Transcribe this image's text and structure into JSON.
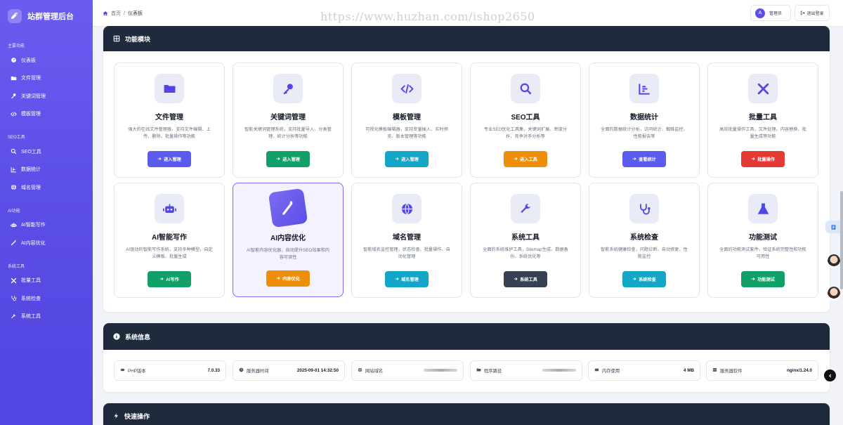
{
  "app": {
    "title": "站群管理后台"
  },
  "sidebar": {
    "sections": [
      {
        "title": "主要功能",
        "items": [
          {
            "label": "仪表板",
            "icon": "dashboard-icon"
          },
          {
            "label": "文件管理",
            "icon": "folder-icon"
          },
          {
            "label": "关键词管理",
            "icon": "key-icon"
          },
          {
            "label": "模板管理",
            "icon": "code-icon"
          }
        ]
      },
      {
        "title": "SEO工具",
        "items": [
          {
            "label": "SEO工具",
            "icon": "search-icon"
          },
          {
            "label": "数据统计",
            "icon": "chart-icon"
          },
          {
            "label": "域名管理",
            "icon": "globe-icon"
          }
        ]
      },
      {
        "title": "AI功能",
        "items": [
          {
            "label": "AI智能写作",
            "icon": "robot-icon"
          },
          {
            "label": "AI内容优化",
            "icon": "magic-icon"
          }
        ]
      },
      {
        "title": "系统工具",
        "items": [
          {
            "label": "批量工具",
            "icon": "tools-icon"
          },
          {
            "label": "系统检查",
            "icon": "stethoscope-icon"
          },
          {
            "label": "系统工具",
            "icon": "wrench-icon"
          }
        ]
      }
    ]
  },
  "topbar": {
    "breadcrumb": {
      "home": "首页",
      "separator": "/",
      "current": "仪表板"
    },
    "watermark": "https://www.huzhan.com/ishop2650",
    "user": {
      "avatar": "A",
      "name": "管理员"
    },
    "logout": "退出登录"
  },
  "modules": {
    "title": "功能模块",
    "items": [
      {
        "title": "文件管理",
        "desc": "强大的在线文件管理器，支持文件编辑、上传、删除、批量操作等功能",
        "button": "进入管理",
        "color": "#5b5bf0",
        "icon": "folder-icon"
      },
      {
        "title": "关键词管理",
        "desc": "智能关键词管理系统，支持批量导入、分类管理、统计分析等功能",
        "button": "进入管理",
        "color": "#10a068",
        "icon": "key-icon"
      },
      {
        "title": "模板管理",
        "desc": "可视化模板编辑器，支持变量插入、实时预览、版本管理等功能",
        "button": "进入管理",
        "color": "#13a6c6",
        "icon": "code-icon"
      },
      {
        "title": "SEO工具",
        "desc": "专业SEO优化工具集，关键词扩展、密度分析、竞争对手分析等",
        "button": "进入工具",
        "color": "#ee8f0b",
        "icon": "search-icon"
      },
      {
        "title": "数据统计",
        "desc": "全面的数据统计分析，访问统计、蜘蛛监控、性能报告等",
        "button": "查看统计",
        "color": "#5b5bf0",
        "icon": "chart-icon"
      },
      {
        "title": "批量工具",
        "desc": "高效批量操作工具，文件处理、内容替换、批量生成等功能",
        "button": "批量操作",
        "color": "#e53935",
        "icon": "tools-icon"
      },
      {
        "title": "AI智能写作",
        "desc": "AI驱动的智能写作系统，支持多种模型，自定义模板、批量生成",
        "button": "AI写作",
        "color": "#10a068",
        "icon": "robot-icon"
      },
      {
        "title": "AI内容优化",
        "desc": "AI智能内容优化器，自动提升SEO效果和内容可读性",
        "button": "内容优化",
        "color": "#ee8f0b",
        "icon": "magic-icon"
      },
      {
        "title": "域名管理",
        "desc": "智能域名监控管理，状态检查、批量操作、自动化管理",
        "button": "域名管理",
        "color": "#13a6c6",
        "icon": "globe-icon"
      },
      {
        "title": "系统工具",
        "desc": "全面的系统维护工具，Sitemap生成、数据备份、系统优化等",
        "button": "系统工具",
        "color": "#374151",
        "icon": "wrench-icon"
      },
      {
        "title": "系统检查",
        "desc": "智能系统健康检查，问题诊断、自动修复、性能监控",
        "button": "系统检查",
        "color": "#13a6c6",
        "icon": "stethoscope-icon"
      },
      {
        "title": "功能测试",
        "desc": "全面的功能测试套件，验证系统完整性和功能可用性",
        "button": "功能测试",
        "color": "#10a068",
        "icon": "flask-icon"
      }
    ]
  },
  "system_info": {
    "title": "系统信息",
    "items": [
      {
        "label": "PHP版本",
        "value": "7.0.33",
        "icon": "php-icon"
      },
      {
        "label": "服务器时间",
        "value": "2025-09-01 14:32:50",
        "icon": "clock-icon"
      },
      {
        "label": "网站域名",
        "value": "",
        "icon": "globe-icon"
      },
      {
        "label": "程序路径",
        "value": "",
        "icon": "folder-icon"
      },
      {
        "label": "内存使用",
        "value": "4 MB",
        "icon": "memory-icon"
      },
      {
        "label": "服务器软件",
        "value": "nginx/1.24.0",
        "icon": "server-icon"
      }
    ]
  },
  "quick_actions": {
    "title": "快速操作"
  }
}
